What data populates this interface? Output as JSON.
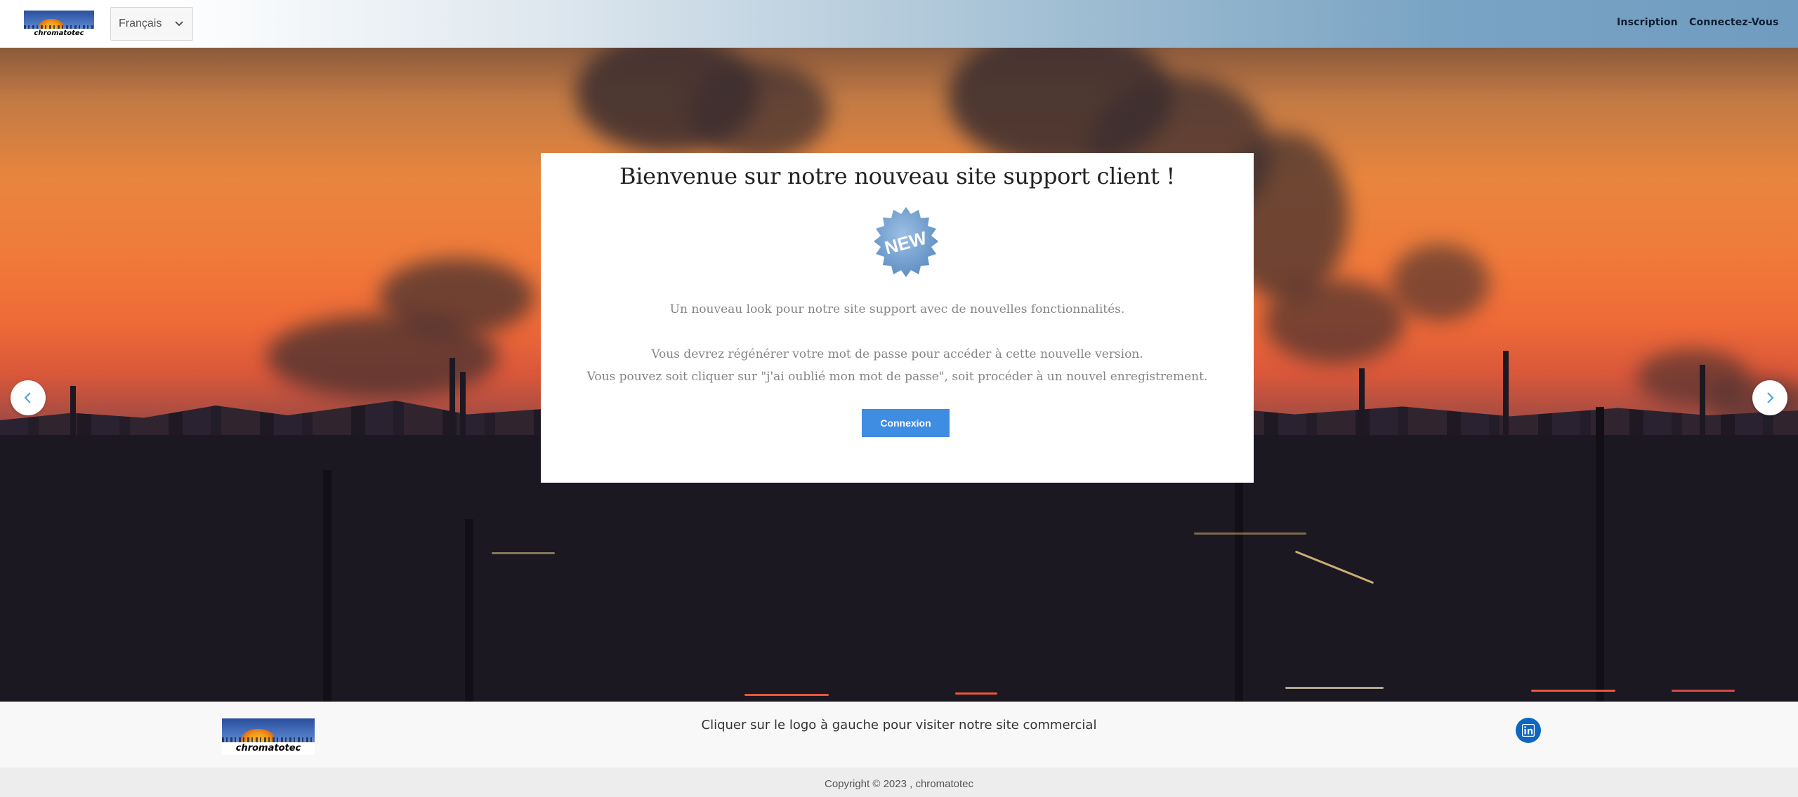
{
  "header": {
    "logo_text": "chromatotec",
    "language_select": {
      "selected": "Français"
    },
    "nav": {
      "signup": "Inscription",
      "login": "Connectez-Vous"
    }
  },
  "hero": {
    "card": {
      "title": "Bienvenue sur notre nouveau site support client !",
      "badge_text": "NEW",
      "line1": "Un nouveau look pour notre site support avec de nouvelles fonctionnalités.",
      "line2": "Vous devrez régénérer votre mot de passe pour accéder à cette nouvelle version.",
      "line3": "Vous pouvez soit cliquer sur \"j'ai oublié mon mot de passe\", soit procéder à un nouvel enregistrement.",
      "button_label": "Connexion"
    },
    "carousel": {
      "prev_icon": "chevron-left-icon",
      "next_icon": "chevron-right-icon"
    }
  },
  "footer": {
    "logo_text": "chromatotec",
    "text": "Cliquer sur le logo à gauche pour visiter notre site commercial",
    "social_icon": "linkedin-icon",
    "copyright": "Copyright © 2023 , chromatotec"
  },
  "colors": {
    "accent": "#3f8ce3",
    "linkedin": "#0d66c2",
    "footer_bg": "#f8f8f8",
    "copyright_bg": "#ededed"
  }
}
